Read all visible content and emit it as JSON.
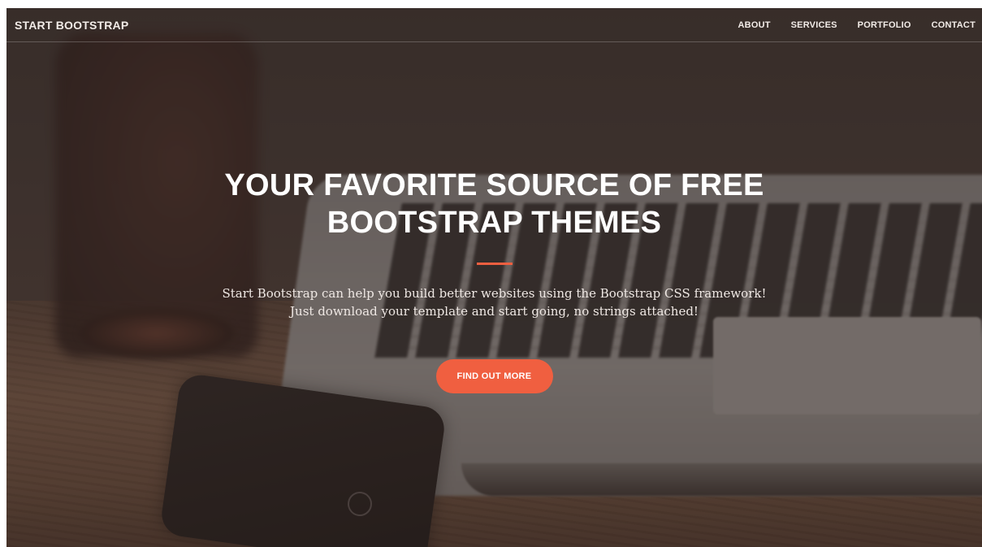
{
  "navbar": {
    "brand": "START BOOTSTRAP",
    "links": [
      {
        "label": "ABOUT"
      },
      {
        "label": "SERVICES"
      },
      {
        "label": "PORTFOLIO"
      },
      {
        "label": "CONTACT"
      }
    ]
  },
  "hero": {
    "title_line1": "YOUR FAVORITE SOURCE OF FREE",
    "title_line2": "BOOTSTRAP THEMES",
    "subtitle_line1": "Start Bootstrap can help you build better websites using the Bootstrap CSS framework!",
    "subtitle_line2": "Just download your template and start going, no strings attached!",
    "cta_label": "FIND OUT MORE"
  },
  "colors": {
    "accent": "#f05f40",
    "text": "#ffffff",
    "overlay": "#342824"
  }
}
